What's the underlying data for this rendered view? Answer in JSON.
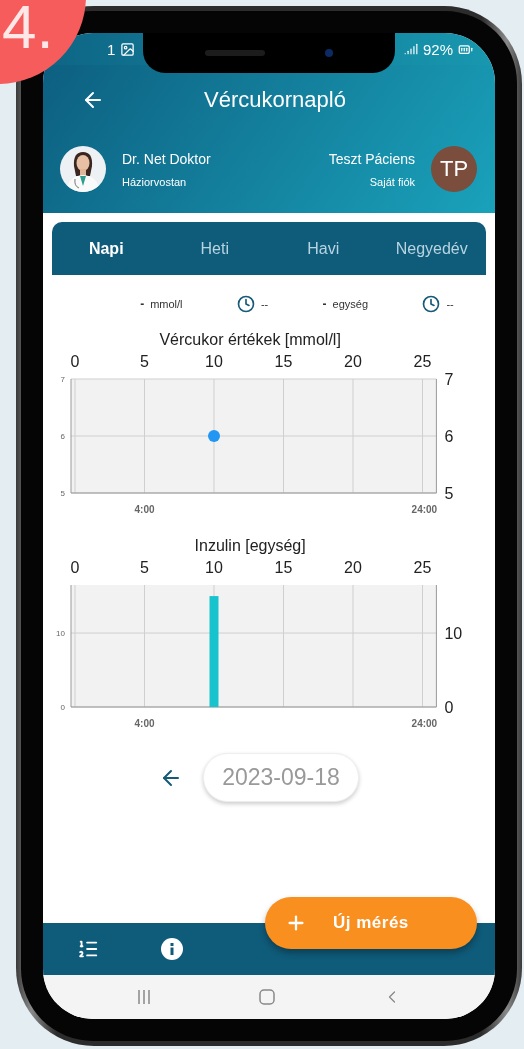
{
  "step_badge": "4.",
  "status_bar": {
    "time": "1",
    "battery": "92%"
  },
  "header": {
    "title": "Vércukornapló"
  },
  "doctor": {
    "name": "Dr. Net Doktor",
    "specialty": "Háziorvostan"
  },
  "patient": {
    "name": "Teszt Páciens",
    "subtitle": "Saját fiók",
    "initials": "TP"
  },
  "tabs": [
    {
      "label": "Napi",
      "selected": true
    },
    {
      "label": "Heti",
      "selected": false
    },
    {
      "label": "Havi",
      "selected": false
    },
    {
      "label": "Negyedév",
      "selected": false
    }
  ],
  "legend": [
    {
      "kind": "value",
      "value": "-",
      "unit": "mmol/l"
    },
    {
      "kind": "time",
      "value": "--"
    },
    {
      "kind": "value",
      "value": "-",
      "unit": "egység"
    },
    {
      "kind": "time",
      "value": "--"
    }
  ],
  "charts": [
    {
      "chart_data": {
        "type": "scatter",
        "title": "Vércukor értékek [mmol/l]",
        "x": [
          10
        ],
        "series": [
          {
            "color": "#2196f3",
            "values": [
              6
            ]
          }
        ],
        "xlim": [
          0,
          26
        ],
        "ylim": [
          5,
          7
        ],
        "xticks": [
          0,
          5,
          10,
          15,
          20,
          25
        ],
        "yticks": [
          5,
          6,
          7
        ],
        "grid": true
      },
      "left_tick_labels": [
        "7",
        "6",
        "5"
      ],
      "bottom_labels": [
        "4:00",
        "24:00"
      ]
    },
    {
      "chart_data": {
        "type": "bar",
        "title": "Inzulin [egység]",
        "x": [
          10
        ],
        "series": [
          {
            "color": "#17c3cc",
            "values": [
              15
            ]
          }
        ],
        "xlim": [
          0,
          26
        ],
        "ylim": [
          0,
          16.5
        ],
        "xticks": [
          0,
          5,
          10,
          15,
          20,
          25
        ],
        "yticks": [
          0,
          10
        ],
        "grid": true
      },
      "left_tick_labels": [
        "10",
        "0"
      ],
      "bottom_labels": [
        "4:00",
        "24:00"
      ]
    }
  ],
  "date": "2023-09-18",
  "fab": {
    "label": "Új mérés"
  }
}
